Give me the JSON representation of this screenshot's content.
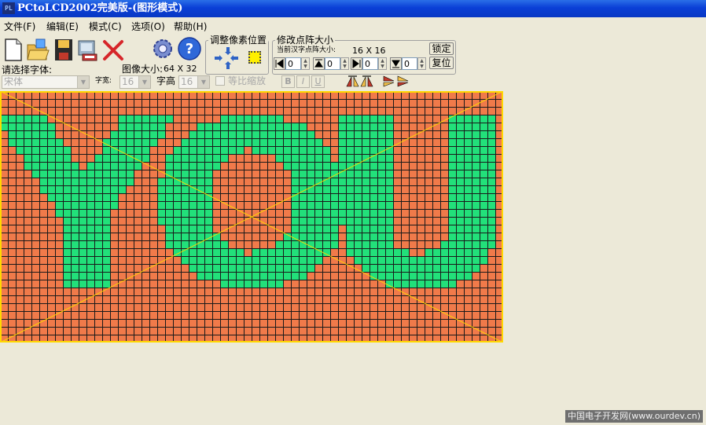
{
  "window": {
    "title": "PCtoLCD2002完美版-(图形模式)",
    "icon_text": "PL"
  },
  "menu": [
    {
      "label": "文件(F)"
    },
    {
      "label": "编辑(E)"
    },
    {
      "label": "模式(C)"
    },
    {
      "label": "选项(O)"
    },
    {
      "label": "帮助(H)"
    }
  ],
  "toolbar": {
    "icons": [
      "new-file-icon",
      "open-folder-icon",
      "save-disk-icon",
      "generate-code-icon",
      "delete-x-icon",
      "settings-gear-icon",
      "help-question-icon"
    ]
  },
  "adjust_pixels": {
    "legend": "调整像素位置"
  },
  "dot_size": {
    "legend": "修改点阵大小",
    "current_label": "当前汉字点阵大小:",
    "current_value": "16 X 16",
    "confirm_label": "锁定",
    "reset_label": "复位",
    "spin_values": [
      "0",
      "0",
      "0",
      "0"
    ]
  },
  "font": {
    "select_label": "请选择字体:",
    "font_value": "宋体",
    "width_label": "字宽:",
    "width_value": "16",
    "height_label": "字高",
    "height_value": "16",
    "proportional_label": "等比缩放",
    "bold_label": "B",
    "italic_label": "I",
    "underline_label": "U"
  },
  "image_size": {
    "label": "图像大小:",
    "value": "64 X 32"
  },
  "canvas": {
    "text": "YOU",
    "cols": 64,
    "rows": 32,
    "on_color": "#22e07a",
    "off_color": "#f07a4a",
    "grid_color": "#1a1a1a",
    "border_color": "#ffd800",
    "diagonal_color": "#ffd800"
  },
  "footer": {
    "text": "中国电子开发网(www.ourdev.cn)"
  }
}
